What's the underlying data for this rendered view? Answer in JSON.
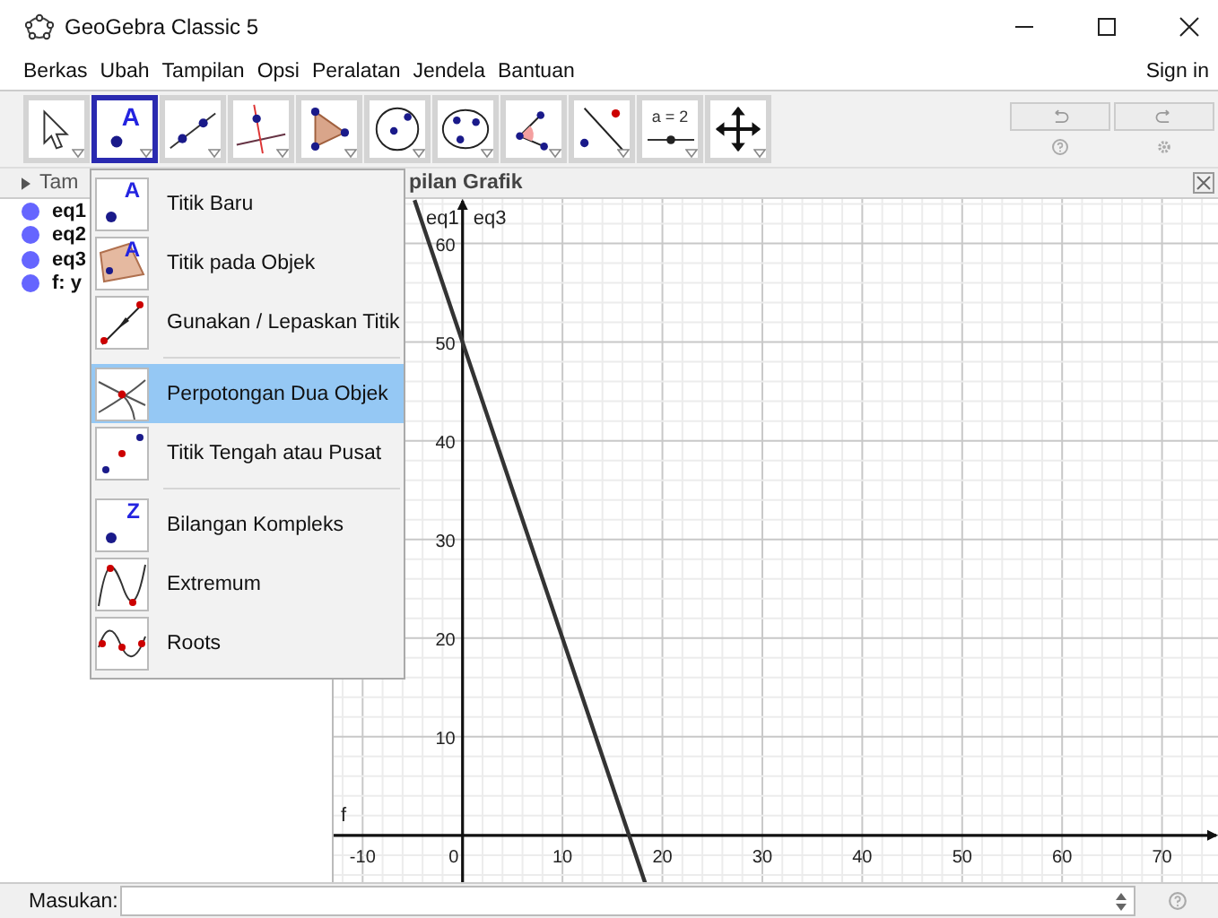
{
  "window": {
    "title": "GeoGebra Classic 5"
  },
  "menu_bar": [
    "Berkas",
    "Ubah",
    "Tampilan",
    "Opsi",
    "Peralatan",
    "Jendela",
    "Bantuan"
  ],
  "sign_in": "Sign in",
  "toolbar": [
    {
      "selected": false
    },
    {
      "selected": true,
      "label": "A"
    },
    {
      "selected": false
    },
    {
      "selected": false
    },
    {
      "selected": false
    },
    {
      "selected": false
    },
    {
      "selected": false
    },
    {
      "selected": false
    },
    {
      "selected": false
    },
    {
      "selected": false,
      "label": "a = 2"
    },
    {
      "selected": false
    }
  ],
  "algebra": {
    "header": "Tam",
    "items": [
      {
        "text": "eq1"
      },
      {
        "text": "eq2"
      },
      {
        "text": "eq3"
      },
      {
        "text": "f: y"
      }
    ]
  },
  "graphics": {
    "header": "pilan Grafik",
    "chart_data": {
      "type": "line",
      "x": [
        -4.8,
        18.3
      ],
      "series": [
        {
          "name": "f",
          "color": "#333333",
          "values": [
            64.4,
            -4.9
          ]
        }
      ],
      "grid": true,
      "xlim": [
        -12.9,
        75.6
      ],
      "ylim": [
        -5.1,
        64.5
      ],
      "xticks": [
        -10,
        0,
        10,
        20,
        30,
        40,
        50,
        60,
        70
      ],
      "yticks": [
        10,
        20,
        30,
        40,
        50,
        60
      ],
      "annotations": [
        "eq1",
        "eq3"
      ]
    }
  },
  "tool_menu": [
    [
      {
        "label": "Titik Baru",
        "selected": false,
        "icon_label": "A"
      },
      {
        "label": "Titik pada Objek",
        "selected": false,
        "icon_label": "A"
      },
      {
        "label": "Gunakan / Lepaskan Titik",
        "selected": false
      }
    ],
    [
      {
        "label": "Perpotongan Dua Objek",
        "selected": true
      },
      {
        "label": "Titik Tengah atau Pusat",
        "selected": false
      }
    ],
    [
      {
        "label": "Bilangan Kompleks",
        "selected": false,
        "icon_label": "Z"
      },
      {
        "label": "Extremum",
        "selected": false
      },
      {
        "label": "Roots",
        "selected": false
      }
    ]
  ],
  "input_bar": {
    "label": "Masukan:"
  }
}
